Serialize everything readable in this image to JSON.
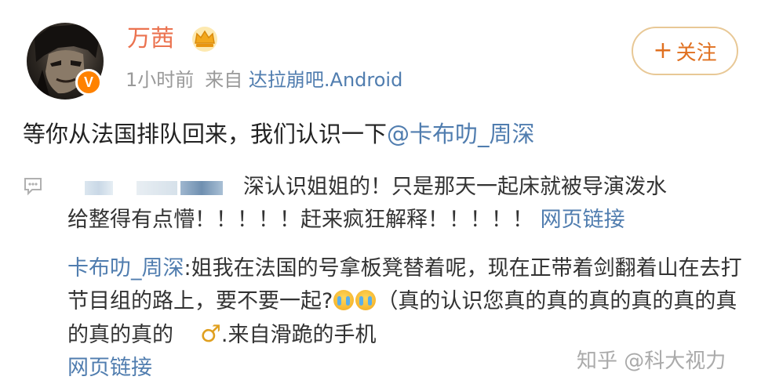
{
  "header": {
    "username": "万茜",
    "time": "1小时前",
    "from_label": "来自",
    "source": "达拉崩吧.Android",
    "follow_label": "关注"
  },
  "post": {
    "text": "等你从法国排队回来，我们认识一下",
    "mention": "@卡布叻_周深"
  },
  "comment1": {
    "line1": "深认识姐姐的！只是那天一起床就被导演泼水",
    "line2": "给整得有点懵！！！！！赶来疯狂解释！！！！！",
    "link": "网页链接"
  },
  "comment2": {
    "author": "卡布叻_周深",
    "text1": ":姐我在法国的号拿板凳替着呢，现在正带着剑翻着山在去打节目组的路上，要不要一起?",
    "text2": "（真的认识您真的真的真的真的真的真的真的真的",
    "male_symbol": "♂",
    "text3": ".来自滑跪的手机",
    "link": "网页链接"
  },
  "watermark": "知乎 @科大视力",
  "colors": {
    "username": "#eb7350",
    "link": "#507daf",
    "follow_border": "#e8c896",
    "follow_text": "#e07020",
    "vip_badge": "#ff8200"
  },
  "icons": {
    "crown": "crown-icon",
    "verified": "verified-badge-icon",
    "comment": "comment-bubble-icon",
    "emoji": "crying-emoji-icon"
  }
}
